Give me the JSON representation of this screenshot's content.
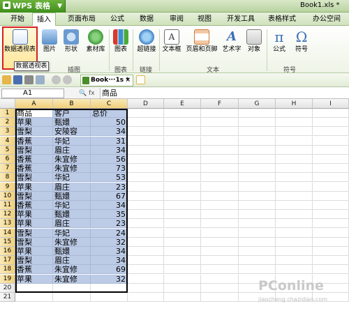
{
  "app": {
    "menu_label": "WPS 表格",
    "doc_title": "Book1.xls *"
  },
  "tabs": [
    {
      "label": "开始"
    },
    {
      "label": "插入"
    },
    {
      "label": "页面布局"
    },
    {
      "label": "公式"
    },
    {
      "label": "数据"
    },
    {
      "label": "审阅"
    },
    {
      "label": "视图"
    },
    {
      "label": "开发工具"
    },
    {
      "label": "表格样式"
    },
    {
      "label": "办公空间"
    }
  ],
  "active_tab": "插入",
  "ribbon": {
    "buttons": [
      {
        "label": "数据透视表",
        "icon": "pivot-table-icon",
        "color": "#4b6ea8"
      },
      {
        "label": "图片",
        "icon": "picture-icon",
        "color": "#5a8fc8"
      },
      {
        "label": "形状",
        "icon": "shapes-icon",
        "color": "#6a9ad0"
      },
      {
        "label": "素材库",
        "icon": "clipart-icon",
        "color": "#3f9a3a"
      },
      {
        "label": "图表",
        "icon": "chart-icon",
        "color": "#d7392f"
      },
      {
        "label": "超链接",
        "icon": "hyperlink-icon",
        "color": "#3c7fc4"
      },
      {
        "label": "文本框",
        "icon": "textbox-icon",
        "color": "#6e6e6e"
      },
      {
        "label": "页眉和页脚",
        "icon": "header-footer-icon",
        "color": "#c87a3c"
      },
      {
        "label": "艺术字",
        "icon": "wordart-icon",
        "color": "#3a6fb5"
      },
      {
        "label": "对象",
        "icon": "object-icon",
        "color": "#7a7a7a"
      },
      {
        "label": "公式",
        "icon": "pi-icon",
        "color": "#3a6fb5"
      },
      {
        "label": "符号",
        "icon": "omega-icon",
        "color": "#3a6fb5"
      }
    ],
    "groups": [
      {
        "label": "插图"
      },
      {
        "label": "图表"
      },
      {
        "label": "链接"
      },
      {
        "label": "文本"
      },
      {
        "label": "符号"
      }
    ],
    "tooltip": "数据透视表",
    "pi_glyph": "π",
    "omega_glyph": "Ω"
  },
  "doc_tab": {
    "label": "Book···1s *",
    "close": "×"
  },
  "formula_bar": {
    "name_box": "A1",
    "fx": "fx",
    "content": "商品"
  },
  "grid": {
    "columns": [
      "A",
      "B",
      "C",
      "D",
      "E",
      "F",
      "G",
      "H",
      "I"
    ],
    "rows": [
      {
        "n": "1",
        "a": "商品",
        "b": "客户",
        "c": "总价"
      },
      {
        "n": "2",
        "a": "苹果",
        "b": "甄嬛",
        "c": "50"
      },
      {
        "n": "3",
        "a": "雪梨",
        "b": "安陵容",
        "c": "34"
      },
      {
        "n": "4",
        "a": "香蕉",
        "b": "华妃",
        "c": "31"
      },
      {
        "n": "5",
        "a": "雪梨",
        "b": "眉庄",
        "c": "34"
      },
      {
        "n": "6",
        "a": "香蕉",
        "b": "朱宜修",
        "c": "56"
      },
      {
        "n": "7",
        "a": "香蕉",
        "b": "朱宜修",
        "c": "73"
      },
      {
        "n": "8",
        "a": "雪梨",
        "b": "华妃",
        "c": "53"
      },
      {
        "n": "9",
        "a": "苹果",
        "b": "眉庄",
        "c": "23"
      },
      {
        "n": "10",
        "a": "雪梨",
        "b": "甄嬛",
        "c": "67"
      },
      {
        "n": "11",
        "a": "香蕉",
        "b": "华妃",
        "c": "34"
      },
      {
        "n": "12",
        "a": "苹果",
        "b": "甄嬛",
        "c": "35"
      },
      {
        "n": "13",
        "a": "苹果",
        "b": "眉庄",
        "c": "23"
      },
      {
        "n": "14",
        "a": "雪梨",
        "b": "华妃",
        "c": "24"
      },
      {
        "n": "15",
        "a": "雪梨",
        "b": "朱宜修",
        "c": "32"
      },
      {
        "n": "16",
        "a": "苹果",
        "b": "甄嬛",
        "c": "34"
      },
      {
        "n": "17",
        "a": "雪梨",
        "b": "眉庄",
        "c": "34"
      },
      {
        "n": "18",
        "a": "香蕉",
        "b": "朱宜修",
        "c": "69"
      },
      {
        "n": "19",
        "a": "苹果",
        "b": " 朱宜修",
        "c": "32"
      },
      {
        "n": "20",
        "a": "",
        "b": "",
        "c": ""
      },
      {
        "n": "21",
        "a": "",
        "b": "",
        "c": ""
      }
    ]
  },
  "watermark": {
    "brand": "PConline",
    "site": "jiaocheng.chazidian.com"
  },
  "colors": {
    "accent": "#3f8f1c",
    "selection": "#bccbe6",
    "highlight_border": "#d52020"
  }
}
